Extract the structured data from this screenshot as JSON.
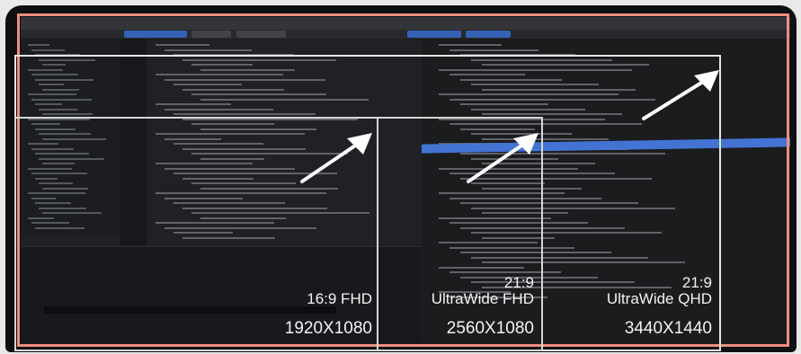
{
  "frames": [
    {
      "kind": "16:9 frame",
      "aspect": "16:9 FHD",
      "resolution": "1920X1080"
    },
    {
      "kind": "ultrawide fhd frame",
      "aspect": "21:9",
      "name": "UltraWide FHD",
      "resolution": "2560X1080"
    },
    {
      "kind": "ultrawide qhd frame",
      "aspect": "21:9",
      "name": "UltraWide QHD",
      "resolution": "3440X1440"
    }
  ],
  "colors": {
    "border": "#ee8d7e",
    "frame": "#d6d6d6",
    "accent": "#4d84f1",
    "text": "#f2f2f2"
  },
  "icons": [
    "arrow-icon",
    "arrow-icon",
    "arrow-icon"
  ]
}
